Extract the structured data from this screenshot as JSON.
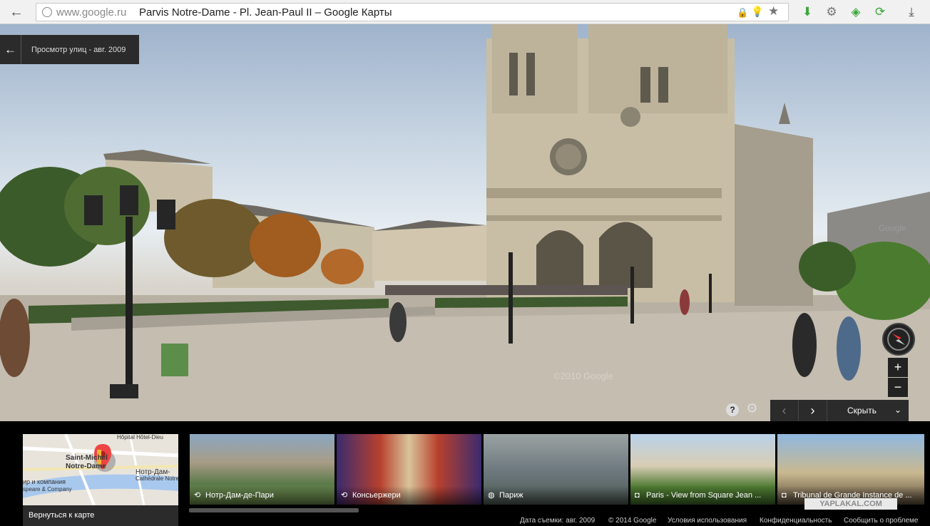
{
  "browser": {
    "domain": "www.google.ru",
    "page_title": "Parvis Notre-Dame - Pl. Jean-Paul II – Google Карты",
    "back_icon": "arrow-left-icon",
    "page_icon": "page-icon",
    "lock_icon": "lock-icon",
    "bulb_icon": "lightbulb-icon",
    "star_icon": "star-icon",
    "extensions": [
      "download-green-icon",
      "translate-icon",
      "shield-icon",
      "refresh-icon",
      "download-icon"
    ]
  },
  "streetview": {
    "chip_label": "Просмотр улиц - авг. 2009",
    "back_icon": "arrow-left-icon",
    "watermarks": [
      "©2010 Google",
      "Google"
    ],
    "zoom_in": "+",
    "zoom_out": "−",
    "compass_icon": "compass-icon",
    "help_label": "?",
    "gear_icon": "gear-icon",
    "hide_label": "Скрыть",
    "prev_icon": "chevron-left-icon",
    "next_icon": "chevron-right-icon",
    "collapse_icon": "chevron-double-down-icon"
  },
  "minimap": {
    "labels": [
      "Hôpital Hôtel-Dieu",
      "Saint-Michel",
      "Notre-Dame",
      "Нотр-Дам-",
      "Cathédrale Notre",
      "ир и компания",
      "speare & Company"
    ],
    "return_label": "Вернуться к карте"
  },
  "thumbnails": [
    {
      "caption": "Нотр-Дам-де-Пари",
      "icon": "360-icon",
      "colors": [
        "#8aa7c2",
        "#5c7a4a",
        "#a89c86"
      ]
    },
    {
      "caption": "Консьержери",
      "icon": "360-icon",
      "colors": [
        "#3b2b6e",
        "#b8402e",
        "#d8c49a"
      ]
    },
    {
      "caption": "Париж",
      "icon": "globe-icon",
      "colors": [
        "#6f7a80",
        "#4d5a52",
        "#9aa2a2"
      ]
    },
    {
      "caption": "Paris - View from Square Jean ...",
      "icon": "camera-icon",
      "colors": [
        "#b9d2ea",
        "#d8cdb4",
        "#4f7a33"
      ]
    },
    {
      "caption": "Tribunal de Grande Instance de ...",
      "icon": "camera-icon",
      "colors": [
        "#8fb8e0",
        "#c9b88f",
        "#5a4c3a"
      ]
    }
  ],
  "footer": {
    "date": "Дата съемки: авг. 2009",
    "copyright": "© 2014 Google",
    "terms": "Условия использования",
    "privacy": "Конфиденциальность",
    "report": "Сообщить о проблеме"
  },
  "watermark": "YAPLAKAL.COM"
}
